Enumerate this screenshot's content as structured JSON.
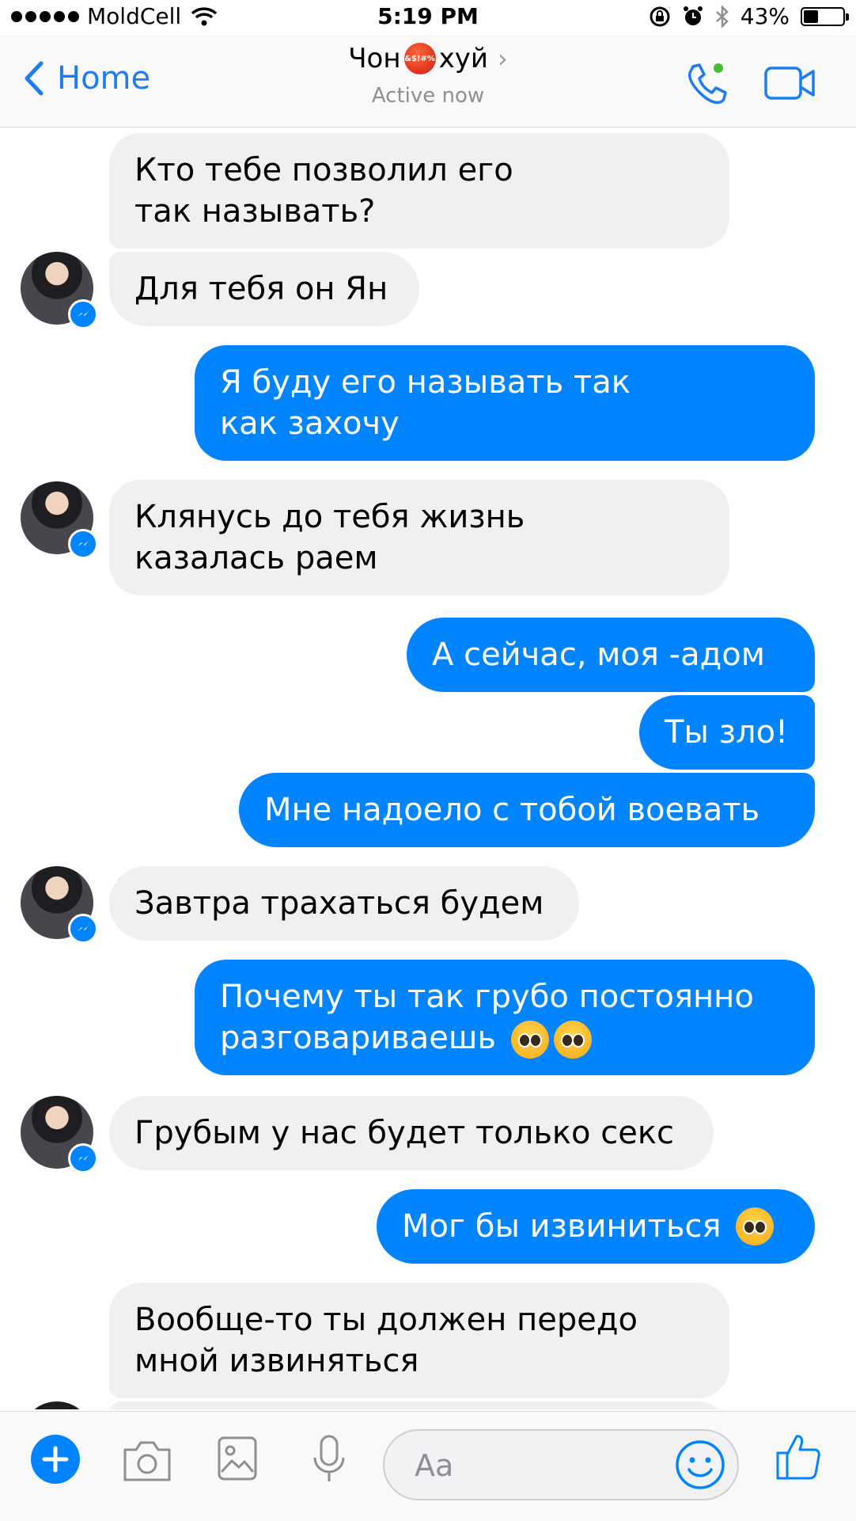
{
  "status_bar": {
    "carrier": "MoldCell",
    "time": "5:19 PM",
    "battery": "43%",
    "battery_level": 0.43
  },
  "nav": {
    "back_label": "Home",
    "title_prefix": "Чон",
    "title_emoji_text": "&$!#%",
    "title_suffix": "хуй",
    "subtitle": "Active now"
  },
  "messages": [
    {
      "side": "in",
      "lines": [
        "Кто тебе позволил его",
        "так называть?"
      ]
    },
    {
      "side": "in",
      "lines": [
        "Для тебя он Ян"
      ]
    },
    {
      "side": "out",
      "lines": [
        "Я буду его называть так",
        "как захочу"
      ]
    },
    {
      "side": "in",
      "lines": [
        "Клянусь до тебя жизнь",
        "казалась раем"
      ]
    },
    {
      "side": "out",
      "lines": [
        "А сейчас, моя -адом"
      ]
    },
    {
      "side": "out",
      "lines": [
        "Ты зло!"
      ]
    },
    {
      "side": "out",
      "lines": [
        "Мне надоело с тобой воевать"
      ]
    },
    {
      "side": "in",
      "lines": [
        "Завтра трахаться будем"
      ]
    },
    {
      "side": "out",
      "lines": [
        "Почему ты так грубо постоянно",
        "разговариваешь"
      ]
    },
    {
      "side": "in",
      "lines": [
        "Грубым у нас будет только секс"
      ]
    },
    {
      "side": "out",
      "lines": [
        "Мог бы извиниться"
      ]
    },
    {
      "side": "in",
      "lines": [
        "Вообще-то ты должен передо",
        "мной извиняться"
      ]
    }
  ],
  "composer": {
    "placeholder": "Aa"
  },
  "colors": {
    "accent": "#0084ff",
    "nav_blue": "#1d7cf2",
    "incoming_bubble": "#f1f0f0",
    "online_dot": "#44bd32"
  },
  "icons": [
    "plus-icon",
    "camera-icon",
    "image-icon",
    "microphone-icon",
    "smiley-icon",
    "thumbs-up-icon",
    "phone-icon",
    "video-icon",
    "messenger-icon"
  ]
}
